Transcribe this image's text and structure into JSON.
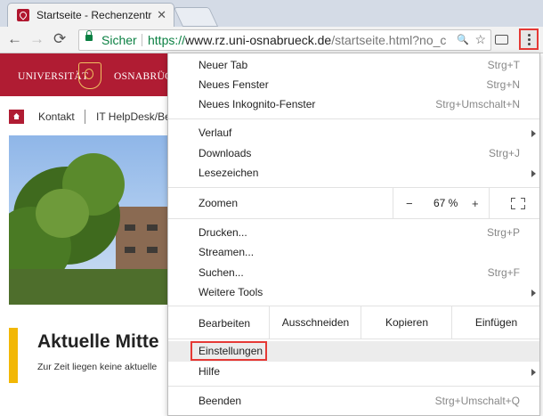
{
  "tab": {
    "title": "Startseite - Rechenzentrum",
    "close_glyph": "✕"
  },
  "toolbar": {
    "back_glyph": "←",
    "forward_glyph": "→",
    "reload_glyph": "⟳",
    "secure_label": "Sicher",
    "url_protocol": "https://",
    "url_host": "www.rz.uni-osnabrueck.de",
    "url_path": "/startseite.html?no_c",
    "zoom_glyph": "🔍",
    "star_glyph": "☆"
  },
  "page": {
    "uni_left": "UNIVERSITÄT",
    "uni_right": "OSNABRÜCK",
    "nav": [
      "Kontakt",
      "IT HelpDesk/Be"
    ],
    "news_title": "Aktuelle Mitte",
    "news_text": "Zur Zeit liegen keine aktuelle"
  },
  "menu": {
    "new_tab": {
      "label": "Neuer Tab",
      "shortcut": "Strg+T"
    },
    "new_window": {
      "label": "Neues Fenster",
      "shortcut": "Strg+N"
    },
    "incognito": {
      "label": "Neues Inkognito-Fenster",
      "shortcut": "Strg+Umschalt+N"
    },
    "history": {
      "label": "Verlauf"
    },
    "downloads": {
      "label": "Downloads",
      "shortcut": "Strg+J"
    },
    "bookmarks": {
      "label": "Lesezeichen"
    },
    "zoom": {
      "label": "Zoomen",
      "minus": "−",
      "value": "67 %",
      "plus": "+"
    },
    "print": {
      "label": "Drucken...",
      "shortcut": "Strg+P"
    },
    "cast": {
      "label": "Streamen..."
    },
    "find": {
      "label": "Suchen...",
      "shortcut": "Strg+F"
    },
    "more_tools": {
      "label": "Weitere Tools"
    },
    "edit": {
      "label": "Bearbeiten",
      "cut": "Ausschneiden",
      "copy": "Kopieren",
      "paste": "Einfügen"
    },
    "settings": {
      "label": "Einstellungen"
    },
    "help": {
      "label": "Hilfe"
    },
    "exit": {
      "label": "Beenden",
      "shortcut": "Strg+Umschalt+Q"
    }
  },
  "colors": {
    "accent_red": "#e53935",
    "uni_red": "#b01c33",
    "secure_green": "#0b8043",
    "news_yellow": "#f2b705"
  }
}
